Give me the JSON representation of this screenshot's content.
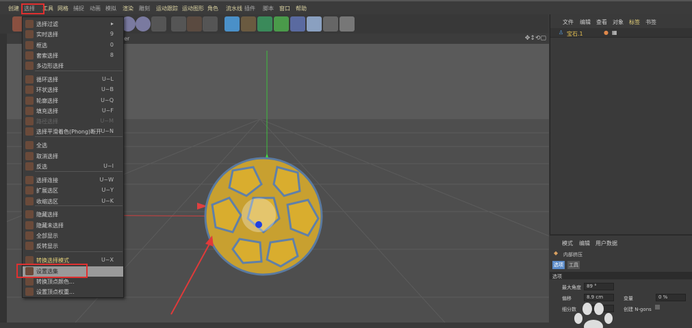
{
  "menubar": [
    "创建",
    "选择",
    "工具",
    "网格",
    "捕捉",
    "动画",
    "模拟",
    "渲染",
    "雕刻",
    "运动跟踪",
    "运动图形",
    "角色",
    "流水线",
    "插件",
    "脚本",
    "窗口",
    "帮助"
  ],
  "viewport": {
    "title": "der"
  },
  "menu": {
    "items": [
      {
        "label": "选择过滤",
        "shortcut": "▸"
      },
      {
        "label": "实时选择",
        "shortcut": "9"
      },
      {
        "label": "框选",
        "shortcut": "0"
      },
      {
        "label": "套索选择",
        "shortcut": "8"
      },
      {
        "label": "多边形选择",
        "shortcut": ""
      },
      {
        "label": "循环选择",
        "shortcut": "U~L"
      },
      {
        "label": "环状选择",
        "shortcut": "U~B"
      },
      {
        "label": "轮廓选择",
        "shortcut": "U~Q"
      },
      {
        "label": "填充选择",
        "shortcut": "U~F"
      },
      {
        "label": "路径选择",
        "shortcut": "U~M"
      },
      {
        "label": "选择平滑着色(Phong)断开",
        "shortcut": "U~N"
      },
      {
        "label": "全选",
        "shortcut": ""
      },
      {
        "label": "取消选择",
        "shortcut": ""
      },
      {
        "label": "反选",
        "shortcut": "U~I"
      },
      {
        "label": "选择连接",
        "shortcut": "U~W"
      },
      {
        "label": "扩展选区",
        "shortcut": "U~Y"
      },
      {
        "label": "收缩选区",
        "shortcut": "U~K"
      },
      {
        "label": "隐藏选择",
        "shortcut": ""
      },
      {
        "label": "隐藏未选择",
        "shortcut": ""
      },
      {
        "label": "全部显示",
        "shortcut": ""
      },
      {
        "label": "反转显示",
        "shortcut": ""
      },
      {
        "label": "转换选择模式",
        "shortcut": "U~X"
      },
      {
        "label": "设置选集",
        "shortcut": ""
      },
      {
        "label": "转换顶点颜色...",
        "shortcut": ""
      },
      {
        "label": "设置顶点权重...",
        "shortcut": ""
      }
    ]
  },
  "objects": {
    "tabs": [
      "文件",
      "编辑",
      "查看",
      "对象",
      "标签",
      "书签"
    ],
    "object_name": "宝石.1"
  },
  "attributes": {
    "tabs": [
      "模式",
      "编辑",
      "用户数据"
    ],
    "tool_name": "内部挤压",
    "subtabs": [
      "选项",
      "工具"
    ],
    "section": "选项",
    "max_angle_label": "最大角度",
    "max_angle": "89 °",
    "offset_label": "偏移",
    "offset": "8.9 cm",
    "variance_label": "变量",
    "variance": "0 %",
    "subdiv_label": "细分数",
    "ngons_label": "创建 N-gons"
  }
}
